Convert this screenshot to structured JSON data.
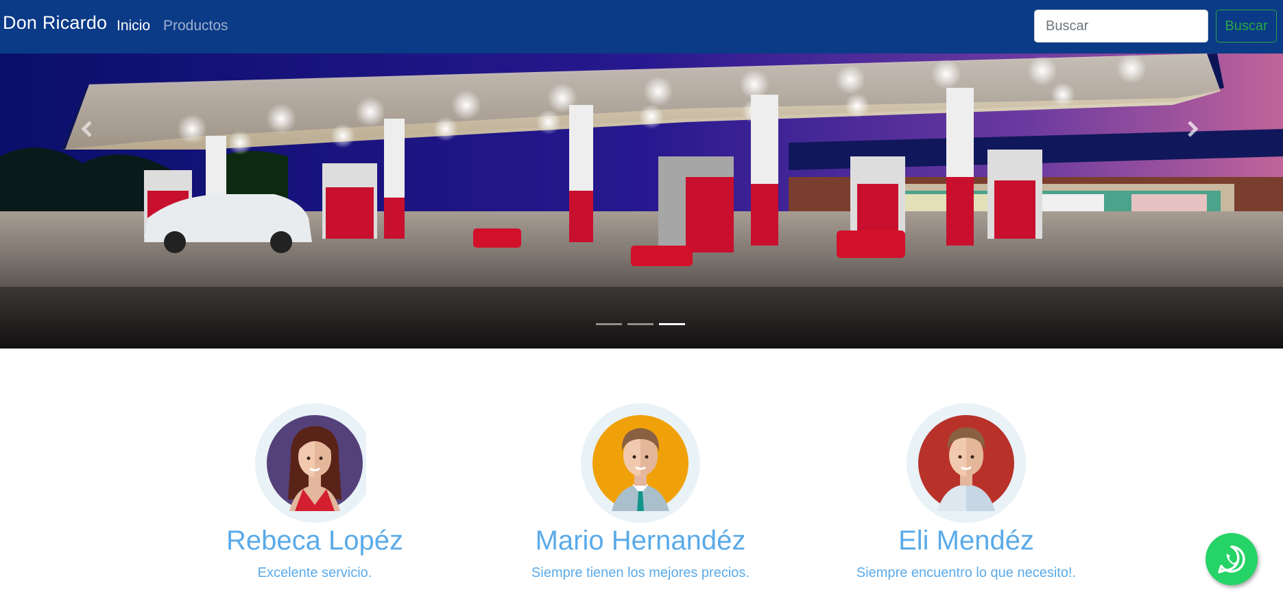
{
  "navbar": {
    "brand": "Don Ricardo",
    "links": [
      {
        "label": "Inicio",
        "active": true
      },
      {
        "label": "Productos",
        "active": false
      }
    ],
    "search": {
      "placeholder": "Buscar",
      "value": "",
      "button_label": "Buscar"
    },
    "bg_color": "#0b3a86"
  },
  "carousel": {
    "slide_count": 3,
    "active_index": 2,
    "prev_icon": "chevron-left-icon",
    "next_icon": "chevron-right-icon"
  },
  "testimonials": [
    {
      "name": "Rebeca Lopéz",
      "quote": "Excelente servicio.",
      "avatar_color": "#54417a"
    },
    {
      "name": "Mario Hernandéz",
      "quote": "Siempre tienen los mejores precios.",
      "avatar_color": "#f0a10a"
    },
    {
      "name": "Eli Mendéz",
      "quote": "Siempre encuentro lo que necesito!.",
      "avatar_color": "#b8322a"
    }
  ],
  "whatsapp": {
    "icon": "whatsapp-icon",
    "color": "#25d366"
  }
}
